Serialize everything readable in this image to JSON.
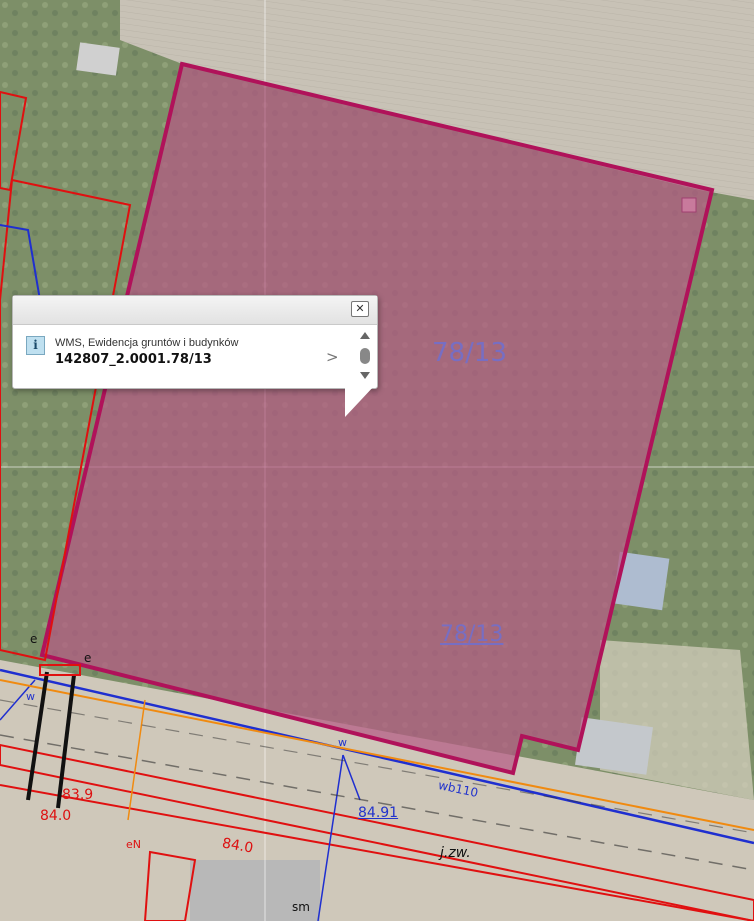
{
  "map": {
    "parcel_label_main": "78/13",
    "parcel_label_secondary": "78/13",
    "dimension_labels": [
      "84.91",
      "84.0",
      "83.9",
      "84.0"
    ],
    "utility_labels": [
      "wb110",
      "w",
      "w",
      "e",
      "e",
      "eN",
      "sm"
    ],
    "road_label": "j.zw.",
    "colors": {
      "parcel_fill": "#b05a7a",
      "parcel_border": "#b0125a",
      "building_outline": "#e01010",
      "water_line": "#1f2fd0",
      "gas_line": "#f08a10",
      "field": "#c9c3b8"
    }
  },
  "popup": {
    "layer_name": "WMS, Ewidencja gruntów i budynków",
    "feature_id": "142807_2.0001.78/13",
    "close_icon": "close-icon",
    "info_icon_glyph": "i",
    "next_glyph": ">"
  }
}
